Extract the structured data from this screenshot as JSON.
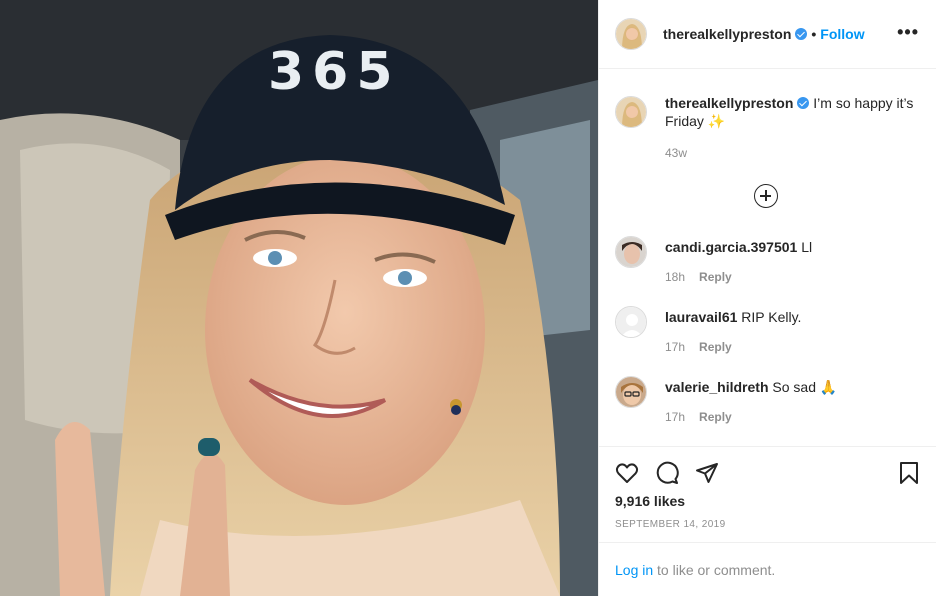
{
  "post": {
    "author": "therealkellypreston",
    "follow_label": "Follow",
    "dot": "•",
    "more_label": "•••",
    "hat_text": "365"
  },
  "caption": {
    "username": "therealkellypreston",
    "text": "I’m so happy it’s Friday ✨",
    "time": "43w"
  },
  "comments": [
    {
      "username": "candi.garcia.397501",
      "text": "Ll",
      "time": "18h",
      "reply": "Reply"
    },
    {
      "username": "lauravail61",
      "text": "RIP Kelly.",
      "time": "17h",
      "reply": "Reply"
    },
    {
      "username": "valerie_hildreth",
      "text": "So sad 🙏",
      "time": "17h",
      "reply": "Reply"
    }
  ],
  "actions": {
    "likes": "9,916 likes",
    "date": "SEPTEMBER 14, 2019"
  },
  "login": {
    "link": "Log in",
    "rest": " to like or comment."
  },
  "colors": {
    "link_blue": "#0095f6",
    "verified_blue": "#3897f0",
    "muted": "#8e8e8e"
  }
}
